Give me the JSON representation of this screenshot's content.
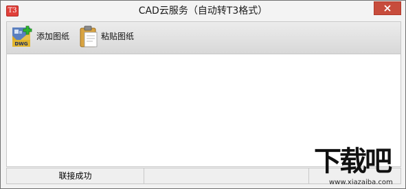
{
  "window": {
    "title": "CAD云服务（自动转T3格式）",
    "app_icon_text": "T3",
    "accent_color": "#c74c3c"
  },
  "toolbar": {
    "add_drawing_label": "添加图纸",
    "add_drawing_icon_text": "DWG",
    "paste_drawing_label": "粘贴图纸"
  },
  "statusbar": {
    "connection_status": "联接成功",
    "cell_2": "",
    "cell_3": ""
  },
  "watermark": {
    "brand": "下载吧",
    "url": "www.xiazaiba.com"
  }
}
